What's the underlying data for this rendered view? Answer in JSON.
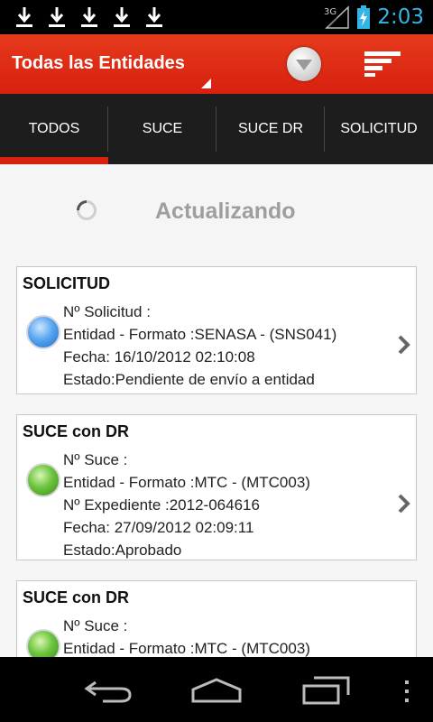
{
  "status_bar": {
    "notification_icons": [
      "download-icon",
      "download-icon",
      "download-icon",
      "download-icon",
      "download-icon"
    ],
    "network": "3G",
    "clock": "2:03"
  },
  "action_bar": {
    "title": "Todas las Entidades"
  },
  "tabs": [
    {
      "label": "TODOS",
      "selected": true
    },
    {
      "label": "SUCE",
      "selected": false
    },
    {
      "label": "SUCE DR",
      "selected": false
    },
    {
      "label": "SOLICITUD",
      "selected": false
    }
  ],
  "refresh": {
    "label": "Actualizando"
  },
  "cards": [
    {
      "title": "SOLICITUD",
      "status_color": "blue",
      "lines": [
        "Nº Solicitud :",
        "Entidad - Formato :SENASA - (SNS041)",
        "Fecha: 16/10/2012 02:10:08",
        "Estado:Pendiente de envío a entidad"
      ]
    },
    {
      "title": "SUCE con DR",
      "status_color": "green",
      "lines": [
        "Nº Suce :",
        "Entidad - Formato :MTC - (MTC003)",
        "Nº Expediente :2012-064616",
        "Fecha: 27/09/2012 02:09:11",
        "Estado:Aprobado"
      ]
    },
    {
      "title": "SUCE con DR",
      "status_color": "green",
      "lines": [
        "Nº Suce :",
        "Entidad - Formato :MTC - (MTC003)"
      ]
    }
  ],
  "colors": {
    "action_bar": "#e0301a",
    "tab_bar": "#1d1d1d",
    "tab_indicator": "#d8200e",
    "clock": "#33b5e5",
    "status_blue": "#3d8ee6",
    "status_green": "#5cb82e"
  }
}
